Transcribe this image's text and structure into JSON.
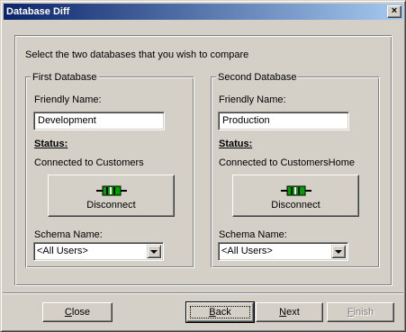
{
  "window": {
    "title": "Database Diff",
    "close_glyph": "×"
  },
  "instruction": "Select the two databases that you wish to compare",
  "first_db": {
    "group_label": "First Database",
    "friendly_name_label": "Friendly Name:",
    "friendly_name_value": "Development",
    "status_label": "Status:",
    "status_text": "Connected to Customers",
    "disconnect_label": "Disconnect",
    "plug_icon": "plug-connector-icon",
    "schema_label": "Schema Name:",
    "schema_value": "<All Users>"
  },
  "second_db": {
    "group_label": "Second Database",
    "friendly_name_label": "Friendly Name:",
    "friendly_name_value": "Production",
    "status_label": "Status:",
    "status_text": "Connected to CustomersHome",
    "disconnect_label": "Disconnect",
    "plug_icon": "plug-connector-icon",
    "schema_label": "Schema Name:",
    "schema_value": "<All Users>"
  },
  "buttons": {
    "close": {
      "first": "C",
      "rest": "lose"
    },
    "back": {
      "first": "B",
      "rest": "ack"
    },
    "next": {
      "first": "N",
      "rest": "ext"
    },
    "finish": {
      "first": "F",
      "rest": "inish",
      "disabled": true
    }
  },
  "colors": {
    "face": "#d4d0c8",
    "title_start": "#0a246a",
    "title_end": "#a6caf0",
    "plug_green": "#00a000"
  }
}
